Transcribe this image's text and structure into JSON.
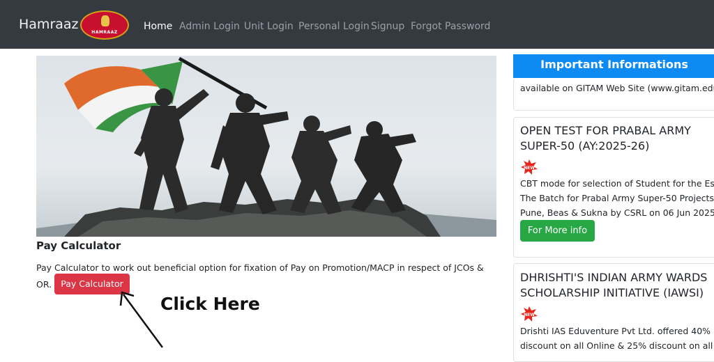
{
  "navbar": {
    "brand": "Hamraaz",
    "emblem_text": "HAMRAAZ",
    "links": [
      {
        "label": "Home",
        "active": true
      },
      {
        "label": "Admin Login"
      },
      {
        "label": "Unit Login"
      },
      {
        "label": "Personal Login"
      },
      {
        "label": "Signup"
      },
      {
        "label": "Forgot Password"
      }
    ]
  },
  "main": {
    "hero_alt": "soldiers-flag-statue-image",
    "pay_title": "Pay Calculator",
    "pay_description": "Pay Calculator to work out beneficial option for fixation of Pay on Promotion/MACP in respect of JCOs &",
    "pay_description_prefix": "OR.",
    "pay_button": "Pay Calculator",
    "annotation": "Click Here"
  },
  "sidebar": {
    "header": "Important Informations",
    "card1_text": "available on GITAM Web Site (www.gitam.edu",
    "card2": {
      "title_line1": "OPEN TEST FOR PRABAL ARMY",
      "title_line2": "SUPER-50 (AY:2025-26)",
      "badge": "NEW",
      "lines": [
        "CBT mode for selection of Student for the Est",
        "The Batch for Prabal Army Super-50 Projects",
        "Pune, Beas & Sukna by CSRL on 06 Jun 2025"
      ],
      "button": "For More info"
    },
    "card3": {
      "title_line1": "DHRISHTI'S INDIAN ARMY WARDS",
      "title_line2": "SCHOLARSHIP INITIATIVE (IAWSI)",
      "badge": "NEW",
      "lines": [
        "Drishti IAS Eduventure Pvt Ltd. offered 40%",
        "discount on all Online & 25% discount on all"
      ]
    }
  },
  "colors": {
    "navbar_bg": "#343a40",
    "danger": "#dc3545",
    "success": "#28a745",
    "primary": "#0d8bf2"
  }
}
